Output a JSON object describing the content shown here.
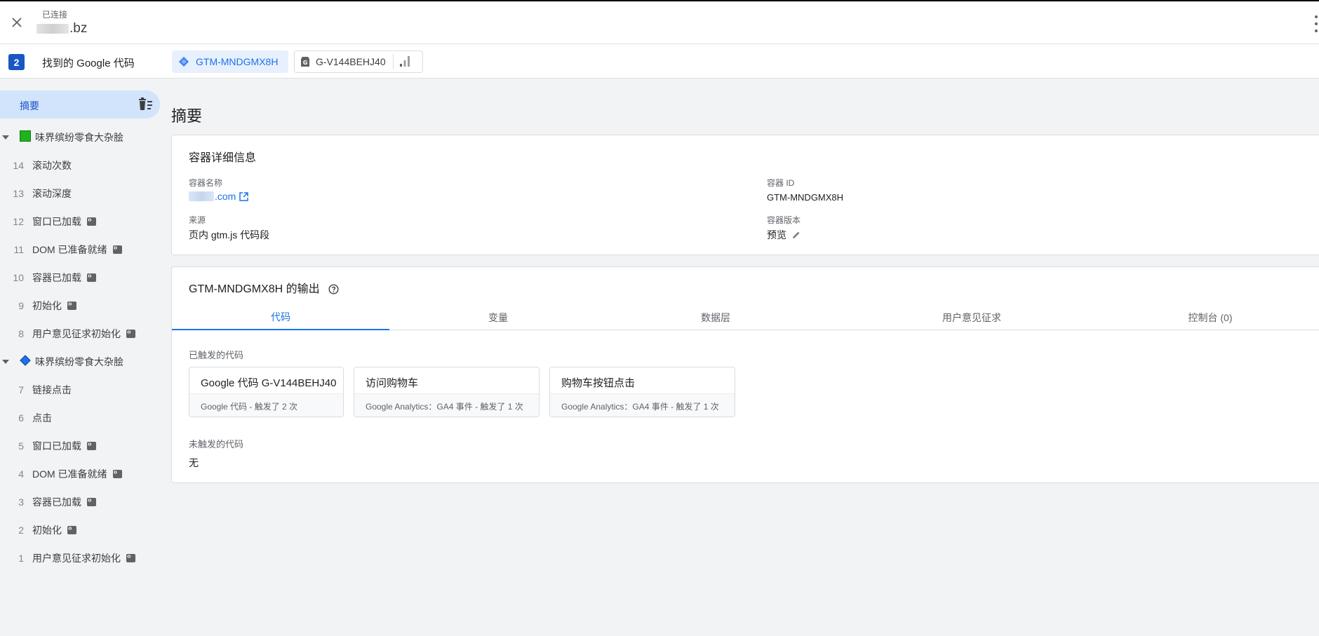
{
  "header": {
    "connection_status": "已连接",
    "site_name": ".bz"
  },
  "tagbar": {
    "count": "2",
    "found_label": "找到的 Google 代码",
    "gtm_container": "GTM-MNDGMX8H",
    "ga_tag": "G-V144BEHJ40"
  },
  "sidebar": {
    "summary_label": "摘要",
    "groups": [
      {
        "label": "味界缤纷零食大杂脍",
        "icon_color": "#1eb41e",
        "events": [
          {
            "num": "14",
            "label": "滚动次数",
            "has_tag": false
          },
          {
            "num": "13",
            "label": "滚动深度",
            "has_tag": false
          },
          {
            "num": "12",
            "label": "窗口已加载",
            "has_tag": true
          },
          {
            "num": "11",
            "label": "DOM 已准备就绪",
            "has_tag": true
          },
          {
            "num": "10",
            "label": "容器已加载",
            "has_tag": true
          },
          {
            "num": "9",
            "label": "初始化",
            "has_tag": true
          },
          {
            "num": "8",
            "label": "用户意见征求初始化",
            "has_tag": true
          }
        ]
      },
      {
        "label": "味界缤纷零食大杂脍",
        "icon_color": "#1a73e8",
        "events": [
          {
            "num": "7",
            "label": "链接点击",
            "has_tag": false
          },
          {
            "num": "6",
            "label": "点击",
            "has_tag": false
          },
          {
            "num": "5",
            "label": "窗口已加载",
            "has_tag": true
          },
          {
            "num": "4",
            "label": "DOM 已准备就绪",
            "has_tag": true
          },
          {
            "num": "3",
            "label": "容器已加载",
            "has_tag": true
          },
          {
            "num": "2",
            "label": "初始化",
            "has_tag": true
          },
          {
            "num": "1",
            "label": "用户意见征求初始化",
            "has_tag": true
          }
        ]
      }
    ]
  },
  "main": {
    "title": "摘要",
    "container_details": {
      "title": "容器详细信息",
      "name_label": "容器名称",
      "name_value": ".com",
      "id_label": "容器 ID",
      "id_value": "GTM-MNDGMX8H",
      "source_label": "来源",
      "source_value": "页内 gtm.js 代码段",
      "version_label": "容器版本",
      "version_value": "预览"
    },
    "output": {
      "title": "GTM-MNDGMX8H 的输出",
      "tabs": [
        "代码",
        "变量",
        "数据层",
        "用户意见征求",
        "控制台 (0)"
      ],
      "fired_label": "已触发的代码",
      "fired_tags": [
        {
          "title": "Google 代码 G-V144BEHJ40",
          "sub": "Google 代码 - 触发了 2 次"
        },
        {
          "title": "访问购物车",
          "sub": "Google Analytics：GA4 事件 - 触发了 1 次"
        },
        {
          "title": "购物车按钮点击",
          "sub": "Google Analytics：GA4 事件 - 触发了 1 次"
        }
      ],
      "not_fired_label": "未触发的代码",
      "not_fired_value": "无"
    }
  }
}
